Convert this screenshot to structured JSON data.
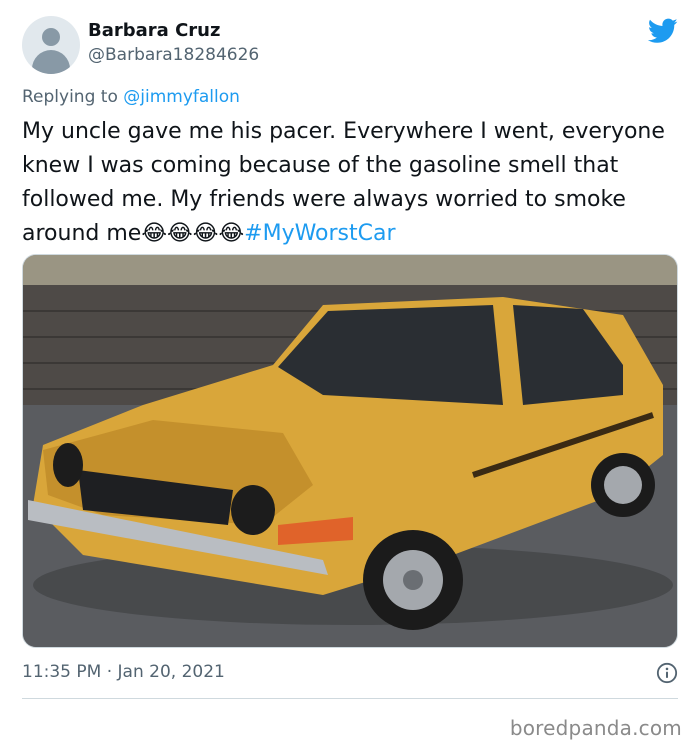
{
  "tweet": {
    "author": {
      "display_name": "Barbara Cruz",
      "handle": "@Barbara18284626"
    },
    "replying_to_prefix": "Replying to ",
    "replying_to_mention": "@jimmyfallon",
    "text": "My uncle gave me his pacer. Everywhere I went, everyone knew I was coming because of the gasoline smell that followed me. My friends were always worried to smoke around me",
    "emojis": "😂😂😂😂",
    "hashtag": "#MyWorstCar",
    "timestamp": "11:35 PM · Jan 20, 2021"
  },
  "icons": {
    "brand": "twitter-bird-icon",
    "info": "info-icon"
  },
  "colors": {
    "accent": "#1d9bf0",
    "secondary_text": "#536471",
    "car_body": "#d9a63a"
  },
  "watermark": "boredpanda.com"
}
